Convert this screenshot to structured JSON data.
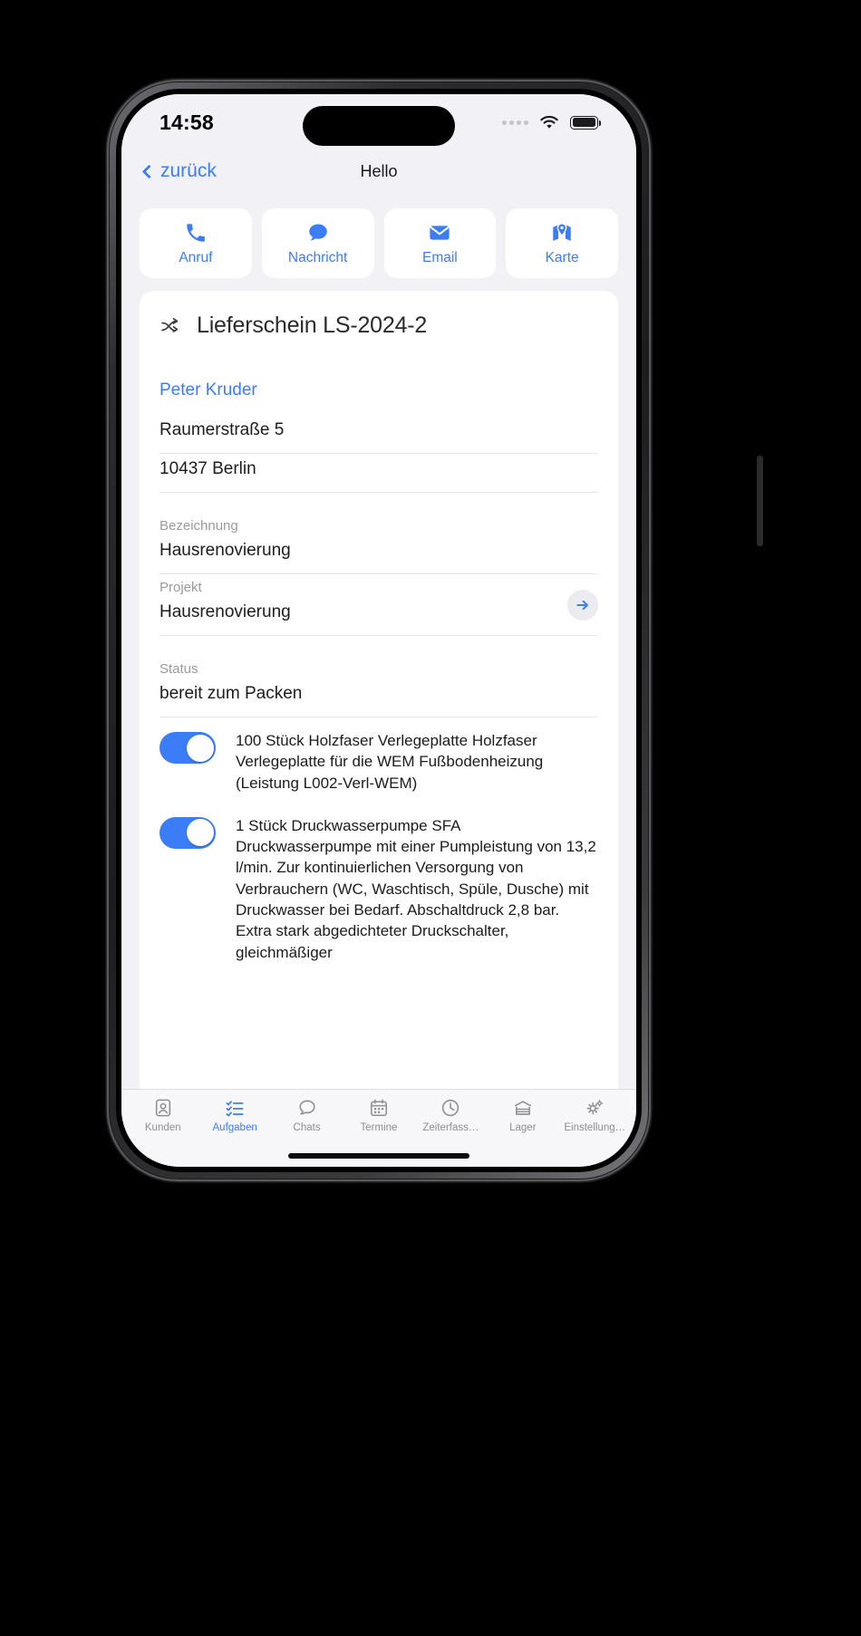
{
  "statusbar": {
    "time": "14:58",
    "wifi_icon": "wifi-icon",
    "battery_icon": "battery-icon",
    "signal_icon": "signal-dots-icon"
  },
  "navbar": {
    "back_label": "zurück",
    "back_icon": "chevron-left-icon",
    "title": "Hello"
  },
  "actions": [
    {
      "label": "Anruf",
      "icon": "phone-icon"
    },
    {
      "label": "Nachricht",
      "icon": "message-bubble-icon"
    },
    {
      "label": "Email",
      "icon": "envelope-icon"
    },
    {
      "label": "Karte",
      "icon": "map-pin-icon"
    }
  ],
  "card": {
    "title": "Lieferschein LS-2024-2",
    "title_icon": "shuffle-icon",
    "contact_name": "Peter Kruder",
    "address_street": "Raumerstraße 5",
    "address_city": "10437 Berlin",
    "fields": [
      {
        "label": "Bezeichnung",
        "value": "Hausrenovierung"
      },
      {
        "label": "Projekt",
        "value": "Hausrenovierung",
        "action_icon": "arrow-right-icon"
      },
      {
        "label": "Status",
        "value": "bereit zum Packen"
      }
    ],
    "items": [
      {
        "enabled": true,
        "text": "100 Stück Holzfaser Verlegeplatte Holzfaser Verlegeplatte für die WEM Fußbodenheizung (Leistung L002-Verl-WEM)"
      },
      {
        "enabled": true,
        "text": "1 Stück Druckwasserpumpe SFA Druckwasserpumpe mit einer Pumpleistung von 13,2 l/min. Zur kontinuierlichen Versorgung von Verbrauchern (WC, Waschtisch, Spüle, Dusche) mit Druckwasser bei Bedarf. Abschaltdruck 2,8 bar. Extra stark abgedichteter Druckschalter, gleichmäßiger"
      }
    ]
  },
  "tabbar": {
    "items": [
      {
        "label": "Kunden",
        "icon": "contact-card-icon",
        "active": false
      },
      {
        "label": "Aufgaben",
        "icon": "checklist-icon",
        "active": true
      },
      {
        "label": "Chats",
        "icon": "chat-bubble-icon",
        "active": false
      },
      {
        "label": "Termine",
        "icon": "calendar-icon",
        "active": false
      },
      {
        "label": "Zeiterfass…",
        "icon": "clock-icon",
        "active": false
      },
      {
        "label": "Lager",
        "icon": "warehouse-icon",
        "active": false
      },
      {
        "label": "Einstellung…",
        "icon": "gears-icon",
        "active": false
      }
    ]
  },
  "colors": {
    "accent": "#3b7df6",
    "screen_bg": "#f1f1f6",
    "card_bg": "#ffffff",
    "muted_text": "#9a9aa0",
    "tab_inactive": "#8e8e93"
  }
}
